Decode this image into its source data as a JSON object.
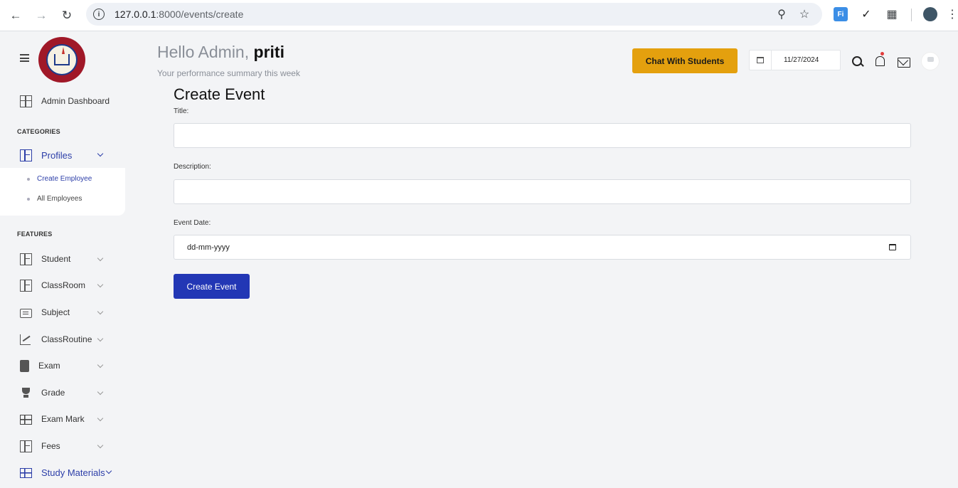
{
  "browser": {
    "url_host": "127.0.0.1",
    "url_rest": ":8000/events/create",
    "ext_label": "Fi"
  },
  "sidebar": {
    "dashboard_label": "Admin Dashboard",
    "categories_label": "CATEGORIES",
    "profiles_label": "Profiles",
    "sub_items": [
      "Create Employee",
      "All Employees"
    ],
    "features_label": "FEATURES",
    "features": [
      "Student",
      "ClassRoom",
      "Subject",
      "ClassRoutine",
      "Exam",
      "Grade",
      "Exam Mark",
      "Fees",
      "Study Materials"
    ]
  },
  "header": {
    "greeting_prefix": "Hello Admin,",
    "user_name": "priti",
    "summary": "Your performance summary this week",
    "chat_button": "Chat With Students",
    "date_value": "11/27/2024"
  },
  "form": {
    "title": "Create Event",
    "title_label": "Title:",
    "description_label": "Description:",
    "event_date_label": "Event Date:",
    "event_date_placeholder": "dd-mm-yyyy",
    "submit_label": "Create Event"
  },
  "colors": {
    "accent": "#2237b5",
    "chat_button": "#e4a00e",
    "active_nav": "#2c3ea8"
  }
}
